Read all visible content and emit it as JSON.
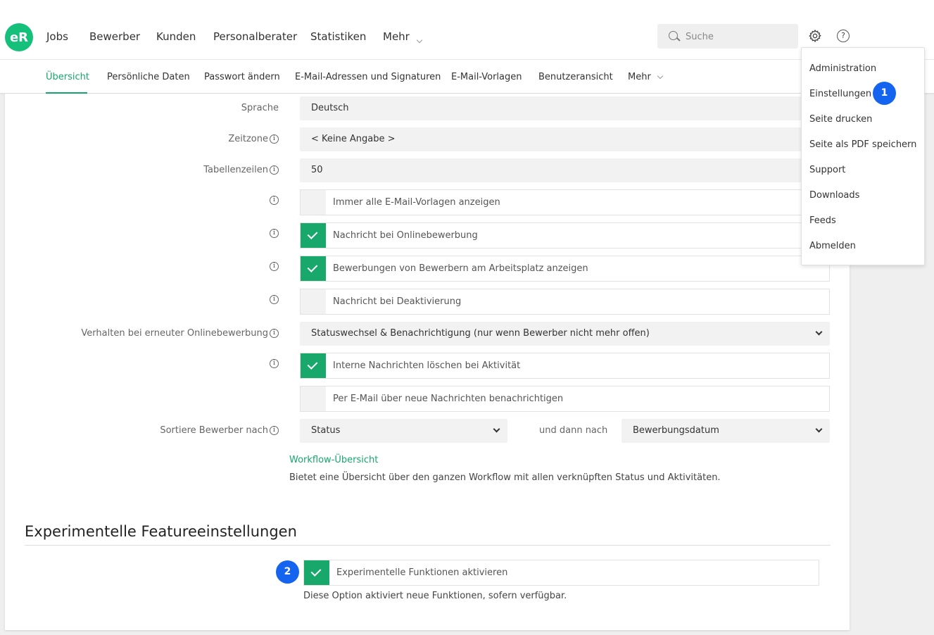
{
  "header": {
    "logo": "eR",
    "nav": [
      "Jobs",
      "Bewerber",
      "Kunden",
      "Personalberater",
      "Statistiken",
      "Mehr"
    ],
    "search_placeholder": "Suche",
    "help_glyph": "?"
  },
  "subnav": {
    "tabs": [
      "Übersicht",
      "Persönliche Daten",
      "Passwort ändern",
      "E-Mail-Adressen und Signaturen",
      "E-Mail-Vorlagen",
      "Benutzeransicht",
      "Mehr"
    ]
  },
  "form": {
    "sprache_label": "Sprache",
    "sprache_value": "Deutsch",
    "zeitzone_label": "Zeitzone",
    "zeitzone_value": "< Keine Angabe >",
    "tabellenzeilen_label": "Tabellenzeilen",
    "tabellenzeilen_value": "50",
    "checkboxes": [
      {
        "label": "Immer alle E-Mail-Vorlagen anzeigen",
        "checked": false
      },
      {
        "label": "Nachricht bei Onlinebewerbung",
        "checked": true
      },
      {
        "label": "Bewerbungen von Bewerbern am Arbeitsplatz anzeigen",
        "checked": true
      },
      {
        "label": "Nachricht bei Deaktivierung",
        "checked": false
      }
    ],
    "verhalten_label": "Verhalten bei erneuter Onlinebewerbung",
    "verhalten_value": "Statuswechsel & Benachrichtigung (nur wenn Bewerber nicht mehr offen)",
    "checkboxes2": [
      {
        "label": "Interne Nachrichten löschen bei Aktivität",
        "checked": true
      },
      {
        "label": "Per E-Mail über neue Nachrichten benachrichtigen",
        "checked": false
      }
    ],
    "sortiere_label": "Sortiere Bewerber nach",
    "sortiere_value": "Status",
    "und_dann_label": "und dann nach",
    "und_dann_value": "Bewerbungsdatum",
    "workflow_link": "Workflow-Übersicht",
    "workflow_desc": "Bietet eine Übersicht über den ganzen Workflow mit allen verknüpften Status und Aktivitäten."
  },
  "experimental": {
    "title": "Experimentelle Featureeinstellungen",
    "checkbox_label": "Experimentelle Funktionen aktivieren",
    "checked": true,
    "desc": "Diese Option aktiviert neue Funktionen, sofern verfügbar."
  },
  "dropdown": {
    "items": [
      "Administration",
      "Einstellungen",
      "Seite drucken",
      "Seite als PDF speichern",
      "Support",
      "Downloads",
      "Feeds",
      "Abmelden"
    ]
  },
  "badges": [
    "1",
    "2"
  ],
  "info_glyph": "i",
  "colors": {
    "accent": "#14a86b",
    "logo": "#14c07a",
    "badge": "#1464f0"
  }
}
